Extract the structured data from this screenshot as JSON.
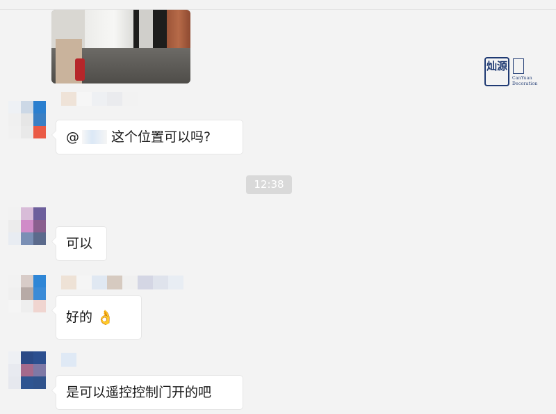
{
  "timestamp": "12:38",
  "logo": {
    "zh_mark": "灿源",
    "en_line1": "CanYuan",
    "en_line2": "Decoration"
  },
  "messages": [
    {
      "text_prefix": "@",
      "text": "这个位置可以吗?"
    },
    {
      "text": "可以"
    },
    {
      "text": "好的",
      "emoji": "👌"
    },
    {
      "text": "是可以遥控控制门开的吧"
    }
  ]
}
